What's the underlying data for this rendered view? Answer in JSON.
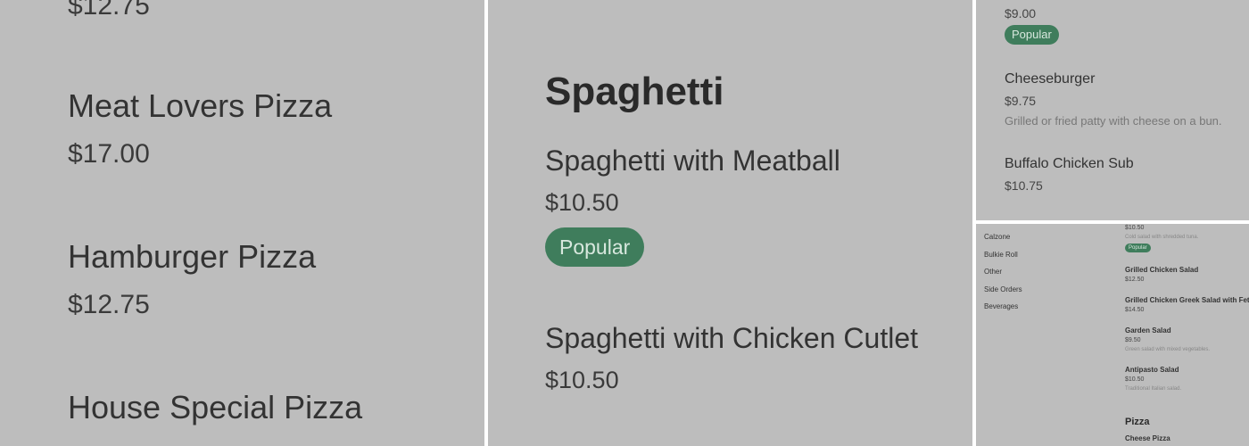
{
  "panel1": {
    "items": [
      {
        "price": "$12.75"
      },
      {
        "name": "Meat Lovers Pizza",
        "price": "$17.00"
      },
      {
        "name": "Hamburger Pizza",
        "price": "$12.75"
      },
      {
        "name": "House Special Pizza"
      }
    ]
  },
  "panel2": {
    "heading": "Spaghetti",
    "items": [
      {
        "name": "Spaghetti with Meatball",
        "price": "$10.50",
        "badge": "Popular"
      },
      {
        "name": "Spaghetti with Chicken Cutlet",
        "price": "$10.50"
      }
    ]
  },
  "panel3": {
    "items": [
      {
        "price": "$9.00",
        "badge": "Popular"
      },
      {
        "name": "Cheeseburger",
        "price": "$9.75",
        "description": "Grilled or fried patty with cheese on a bun."
      },
      {
        "name": "Buffalo Chicken Sub",
        "price": "$10.75"
      }
    ]
  },
  "panel4": {
    "nav": [
      "Calzone",
      "Bulkie Roll",
      "Other",
      "Side Orders",
      "Beverages"
    ],
    "items": [
      {
        "price": "$10.50",
        "description": "Cold salad with shredded tuna.",
        "badge": "Popular"
      },
      {
        "name": "Grilled Chicken Salad",
        "price": "$12.50"
      },
      {
        "name": "Grilled Chicken Greek Salad with Feta",
        "price": "$14.50"
      },
      {
        "name": "Garden Salad",
        "price": "$9.50",
        "description": "Green salad with mixed vegetables."
      },
      {
        "name": "Antipasto Salad",
        "price": "$10.50",
        "description": "Traditional Italian salad."
      }
    ],
    "category": "Pizza",
    "next_item": "Cheese Pizza"
  },
  "colors": {
    "background": "#bdbdbd",
    "badge": "#3f7d5c",
    "separator": "#ffffff"
  }
}
